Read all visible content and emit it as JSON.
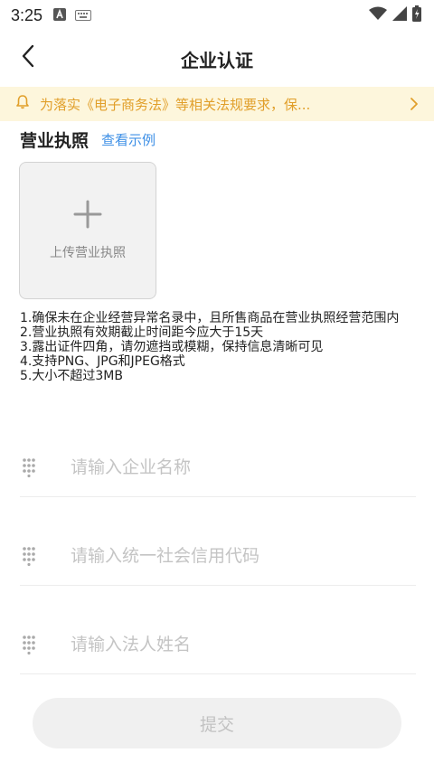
{
  "status_bar": {
    "time": "3:25",
    "left_icons": [
      "font-a-icon",
      "keyboard-icon"
    ],
    "right_icons": [
      "wifi-icon",
      "cellular-icon",
      "battery-icon"
    ]
  },
  "header": {
    "title": "企业认证"
  },
  "notice": {
    "text": "为落实《电子商务法》等相关法规要求，保..."
  },
  "license": {
    "title": "营业执照",
    "example_link": "查看示例",
    "upload_label": "上传营业执照"
  },
  "tips": [
    "1.确保未在企业经营异常名录中，且所售商品在营业执照经营范围内",
    "2.营业执照有效期截止时间距今应大于15天",
    "3.露出证件四角，请勿遮挡或模糊，保持信息清晰可见",
    "4.支持PNG、JPG和JPEG格式",
    "5.大小不超过3MB"
  ],
  "fields": [
    {
      "placeholder": "请输入企业名称",
      "value": ""
    },
    {
      "placeholder": "请输入统一社会信用代码",
      "value": ""
    },
    {
      "placeholder": "请输入法人姓名",
      "value": ""
    }
  ],
  "submit_label": "提交",
  "colors": {
    "notice_bg": "#fdf6dc",
    "notice_text": "#e19f2a",
    "link": "#3d8fe6",
    "button_bg": "#f0f0f0",
    "button_text": "#c2c2c2"
  }
}
